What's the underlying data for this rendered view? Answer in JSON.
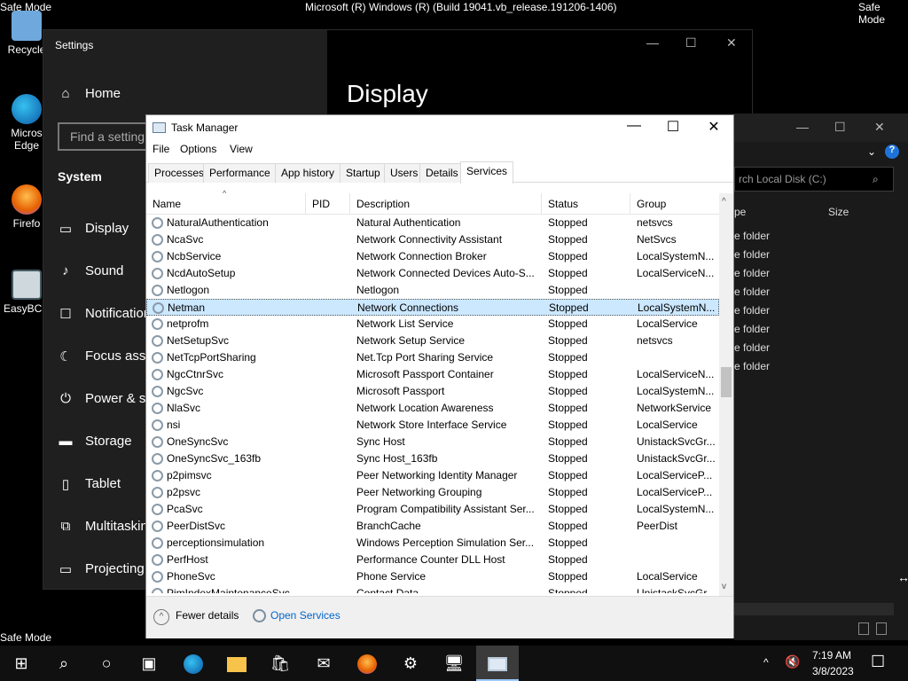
{
  "desktop": {
    "safe_mode_label": "Safe Mode",
    "os_title": "Microsoft (R) Windows (R) (Build 19041.vb_release.191206-1406)",
    "icons": [
      {
        "label": "Recycle",
        "icon": "recycle-bin-icon"
      },
      {
        "label": "Micros Edge",
        "icon": "edge-icon"
      },
      {
        "label": "Firefo",
        "icon": "firefox-icon"
      },
      {
        "label": "EasyBCD",
        "icon": "easybcd-icon"
      }
    ]
  },
  "settings": {
    "title": "Settings",
    "home_label": "Home",
    "search_placeholder": "Find a setting",
    "section": "System",
    "page_title": "Display",
    "items": [
      {
        "label": "Display",
        "icon": "monitor-icon"
      },
      {
        "label": "Sound",
        "icon": "speaker-icon"
      },
      {
        "label": "Notification",
        "icon": "notification-icon"
      },
      {
        "label": "Focus assist",
        "icon": "moon-icon"
      },
      {
        "label": "Power & sle",
        "icon": "power-icon"
      },
      {
        "label": "Storage",
        "icon": "storage-icon"
      },
      {
        "label": "Tablet",
        "icon": "tablet-icon"
      },
      {
        "label": "Multitaskin",
        "icon": "multitasking-icon"
      },
      {
        "label": "Projecting t",
        "icon": "projecting-icon"
      }
    ]
  },
  "explorer": {
    "search_placeholder": "rch Local Disk (C:)",
    "col_type": "pe",
    "col_size": "Size",
    "row_text": "e folder",
    "row_count": 8
  },
  "task_manager": {
    "title": "Task Manager",
    "menu": [
      "File",
      "Options",
      "View"
    ],
    "tabs": [
      "Processes",
      "Performance",
      "App history",
      "Startup",
      "Users",
      "Details",
      "Services"
    ],
    "active_tab": "Services",
    "columns": [
      "Name",
      "PID",
      "Description",
      "Status",
      "Group"
    ],
    "rows": [
      {
        "name": "NaturalAuthentication",
        "pid": "",
        "desc": "Natural Authentication",
        "status": "Stopped",
        "group": "netsvcs"
      },
      {
        "name": "NcaSvc",
        "pid": "",
        "desc": "Network Connectivity Assistant",
        "status": "Stopped",
        "group": "NetSvcs"
      },
      {
        "name": "NcbService",
        "pid": "",
        "desc": "Network Connection Broker",
        "status": "Stopped",
        "group": "LocalSystemN..."
      },
      {
        "name": "NcdAutoSetup",
        "pid": "",
        "desc": "Network Connected Devices Auto-S...",
        "status": "Stopped",
        "group": "LocalServiceN..."
      },
      {
        "name": "Netlogon",
        "pid": "",
        "desc": "Netlogon",
        "status": "Stopped",
        "group": ""
      },
      {
        "name": "Netman",
        "pid": "",
        "desc": "Network Connections",
        "status": "Stopped",
        "group": "LocalSystemN..."
      },
      {
        "name": "netprofm",
        "pid": "",
        "desc": "Network List Service",
        "status": "Stopped",
        "group": "LocalService"
      },
      {
        "name": "NetSetupSvc",
        "pid": "",
        "desc": "Network Setup Service",
        "status": "Stopped",
        "group": "netsvcs"
      },
      {
        "name": "NetTcpPortSharing",
        "pid": "",
        "desc": "Net.Tcp Port Sharing Service",
        "status": "Stopped",
        "group": ""
      },
      {
        "name": "NgcCtnrSvc",
        "pid": "",
        "desc": "Microsoft Passport Container",
        "status": "Stopped",
        "group": "LocalServiceN..."
      },
      {
        "name": "NgcSvc",
        "pid": "",
        "desc": "Microsoft Passport",
        "status": "Stopped",
        "group": "LocalSystemN..."
      },
      {
        "name": "NlaSvc",
        "pid": "",
        "desc": "Network Location Awareness",
        "status": "Stopped",
        "group": "NetworkService"
      },
      {
        "name": "nsi",
        "pid": "",
        "desc": "Network Store Interface Service",
        "status": "Stopped",
        "group": "LocalService"
      },
      {
        "name": "OneSyncSvc",
        "pid": "",
        "desc": "Sync Host",
        "status": "Stopped",
        "group": "UnistackSvcGr..."
      },
      {
        "name": "OneSyncSvc_163fb",
        "pid": "",
        "desc": "Sync Host_163fb",
        "status": "Stopped",
        "group": "UnistackSvcGr..."
      },
      {
        "name": "p2pimsvc",
        "pid": "",
        "desc": "Peer Networking Identity Manager",
        "status": "Stopped",
        "group": "LocalServiceP..."
      },
      {
        "name": "p2psvc",
        "pid": "",
        "desc": "Peer Networking Grouping",
        "status": "Stopped",
        "group": "LocalServiceP..."
      },
      {
        "name": "PcaSvc",
        "pid": "",
        "desc": "Program Compatibility Assistant Ser...",
        "status": "Stopped",
        "group": "LocalSystemN..."
      },
      {
        "name": "PeerDistSvc",
        "pid": "",
        "desc": "BranchCache",
        "status": "Stopped",
        "group": "PeerDist"
      },
      {
        "name": "perceptionsimulation",
        "pid": "",
        "desc": "Windows Perception Simulation Ser...",
        "status": "Stopped",
        "group": ""
      },
      {
        "name": "PerfHost",
        "pid": "",
        "desc": "Performance Counter DLL Host",
        "status": "Stopped",
        "group": ""
      },
      {
        "name": "PhoneSvc",
        "pid": "",
        "desc": "Phone Service",
        "status": "Stopped",
        "group": "LocalService"
      },
      {
        "name": "PimIndexMaintenanceSvc",
        "pid": "",
        "desc": "Contact Data",
        "status": "Stopped",
        "group": "UnistackSvcGr..."
      }
    ],
    "selected_row": "Netman",
    "fewer_details": "Fewer details",
    "open_services": "Open Services"
  },
  "taskbar": {
    "time": "7:19 AM",
    "date": "3/8/2023",
    "icons": [
      "windows-start-icon",
      "search-icon",
      "cortana-icon",
      "task-view-icon",
      "edge-icon",
      "file-explorer-icon",
      "store-icon",
      "mail-icon",
      "firefox-icon",
      "settings-icon",
      "remote-desktop-icon",
      "task-manager-icon"
    ],
    "active_icon": "task-manager-icon"
  }
}
